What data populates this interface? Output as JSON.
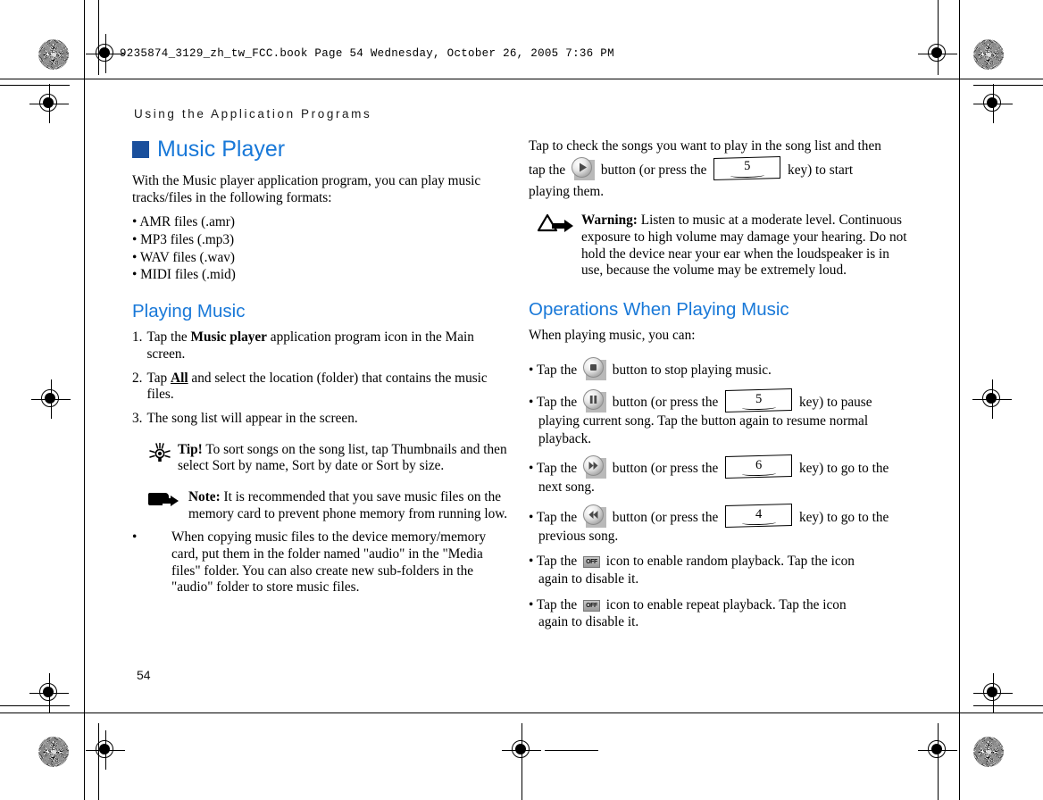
{
  "print_marks": {
    "file_stamp": "9235874_3129_zh_tw_FCC.book  Page 54  Wednesday, October 26, 2005  7:36 PM",
    "running_head": "Using the Application Programs",
    "folio": "54"
  },
  "colors": {
    "heading_blue": "#1878d8",
    "square_blue": "#1a4f9c",
    "body_black": "#000000"
  },
  "left_column": {
    "title": "Music Player",
    "intro": "With the Music player application program, you can play music tracks/files in the following formats:",
    "formats": [
      "• AMR files (.amr)",
      "• MP3 files (.mp3)",
      "• WAV files (.wav)",
      "• MIDI files (.mid)"
    ],
    "section_title": "Playing Music",
    "steps": [
      {
        "num": "1.",
        "pre": "Tap the ",
        "bold": "Music player",
        "post": " application program icon in the Main screen."
      },
      {
        "num": "2.",
        "pre": "Tap ",
        "bold": "All",
        "post": " and select the location (folder) that contains the music files."
      },
      {
        "num": "3.",
        "pre": "The song list will appear in the screen.",
        "bold": "",
        "post": ""
      }
    ],
    "tip": {
      "icon": "lightbulb-icon",
      "label": "Tip!",
      "text": " To sort songs on the song list, tap Thumbnails and then select Sort by name, Sort by date or Sort by size."
    },
    "note": {
      "icon": "note-arrow-icon",
      "label": "Note:",
      "text": " It is recommended that you save music files on the memory card to prevent phone memory from running low."
    },
    "hanging_bullet": {
      "marker": "•",
      "text": "When copying music files to the device memory/memory card, put them in the folder named \"audio\" in the \"Media files\" folder.  You can also create new sub-folders in the \"audio\" folder to store music files."
    }
  },
  "right_column": {
    "intro_1": "Tap to check the songs you want to play in the song list and then",
    "intro_2a": "tap the ",
    "intro_2b": " button (or press the ",
    "intro_2c": " key) to start",
    "intro_3": "playing them.",
    "play_button_icon": "play-button-icon",
    "play_key": "5",
    "warning": {
      "icon": "warning-triangle-arrow-icon",
      "label": "Warning:",
      "text": " Listen to music at a moderate level. Continuous exposure to high volume may damage your hearing. Do not hold the device near your ear when the loudspeaker is in use, because the volume may be extremely loud."
    },
    "section_title": "Operations When Playing Music",
    "lead_in": "When playing music, you can:",
    "operations": [
      {
        "bullet": "•",
        "pre": "Tap the ",
        "icon": "stop-button-icon",
        "mid": " button to stop playing music.",
        "key": null,
        "post": "",
        "cont": ""
      },
      {
        "bullet": "•",
        "pre": "Tap the ",
        "icon": "pause-button-icon",
        "mid": " button (or press the ",
        "key": "5",
        "post": " key) to pause",
        "cont": "playing current song. Tap the button again to resume normal playback."
      },
      {
        "bullet": "•",
        "pre": "Tap the ",
        "icon": "next-button-icon",
        "mid": " button (or press the ",
        "key": "6",
        "post": " key) to go to the",
        "cont": "next song."
      },
      {
        "bullet": "•",
        "pre": "Tap the ",
        "icon": "previous-button-icon",
        "mid": " button (or press the ",
        "key": "4",
        "post": " key) to go to the",
        "cont": "previous song."
      },
      {
        "bullet": "•",
        "pre": "Tap the ",
        "icon": "random-off-icon",
        "icon_label": "OFF",
        "mid": " icon to enable random playback. Tap the icon",
        "key": null,
        "post": "",
        "cont": "again to disable it."
      },
      {
        "bullet": "•",
        "pre": "Tap the ",
        "icon": "repeat-off-icon",
        "icon_label": "OFF",
        "mid": " icon to enable repeat playback. Tap the icon",
        "key": null,
        "post": "",
        "cont": "again to disable it."
      }
    ]
  }
}
